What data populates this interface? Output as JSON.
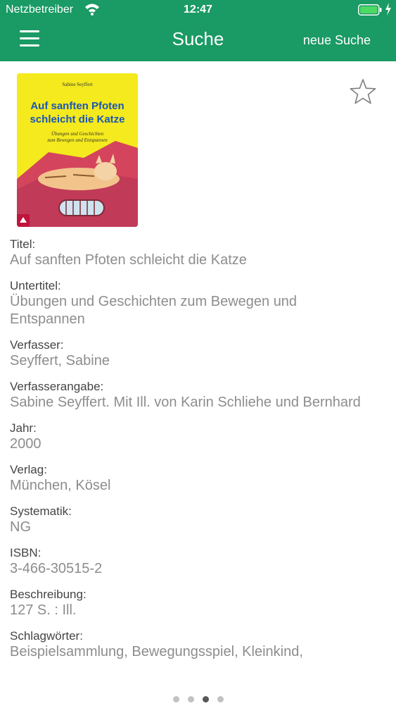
{
  "status": {
    "carrier": "Netzbetreiber",
    "time": "12:47"
  },
  "nav": {
    "title": "Suche",
    "new_search": "neue Suche"
  },
  "cover": {
    "author": "Sabine Seyffert",
    "title_line1": "Auf sanften Pfoten",
    "title_line2": "schleicht die Katze",
    "subtitle_line1": "Übungen und Geschichten",
    "subtitle_line2": "zum Bewegen und Entspannen"
  },
  "fields": [
    {
      "label": "Titel:",
      "value": "Auf sanften Pfoten schleicht die Katze"
    },
    {
      "label": "Untertitel:",
      "value": "Übungen und Geschichten zum Bewegen und Entspannen"
    },
    {
      "label": "Verfasser:",
      "value": "Seyffert, Sabine"
    },
    {
      "label": "Verfasserangabe:",
      "value": "Sabine Seyffert. Mit Ill. von Karin Schliehe und Bernhard"
    },
    {
      "label": "Jahr:",
      "value": "2000"
    },
    {
      "label": "Verlag:",
      "value": "München, Kösel"
    },
    {
      "label": "Systematik:",
      "value": "NG"
    },
    {
      "label": "ISBN:",
      "value": "3-466-30515-2"
    },
    {
      "label": "Beschreibung:",
      "value": "127 S. : Ill."
    },
    {
      "label": "Schlagwörter:",
      "value": "Beispielsammlung, Bewegungsspiel, Kleinkind,"
    }
  ],
  "pager": {
    "count": 4,
    "active": 2
  }
}
